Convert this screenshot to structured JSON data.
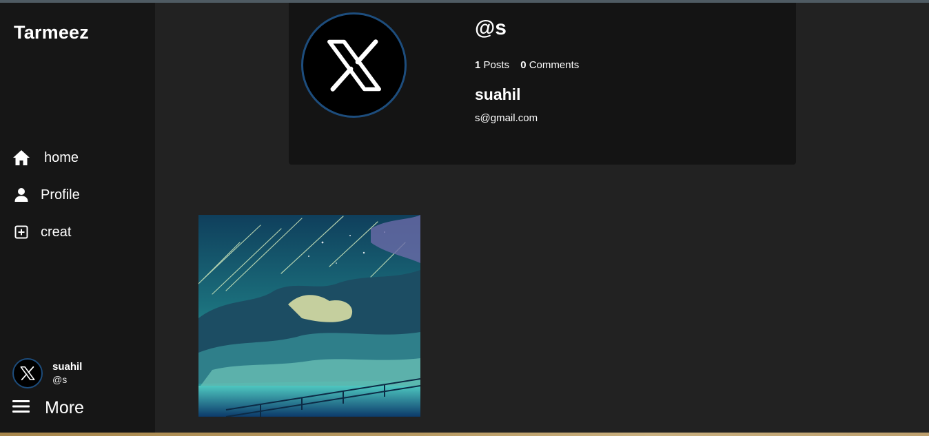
{
  "sidebar": {
    "brand": "Tarmeez",
    "nav": [
      {
        "label": "home",
        "icon": "home-icon"
      },
      {
        "label": "Profile",
        "icon": "user-icon"
      },
      {
        "label": "creat",
        "icon": "plus-square-icon"
      }
    ],
    "user": {
      "name": "suahil",
      "handle": "@s",
      "avatar_icon": "x-logo-icon"
    },
    "more_label": "More",
    "more_icon": "hamburger-menu-icon"
  },
  "profile": {
    "avatar_icon": "x-logo-icon",
    "handle": "@s",
    "posts_count": "1",
    "posts_label": "Posts",
    "comments_count": "0",
    "comments_label": "Comments",
    "name": "suahil",
    "email": "s@gmail.com"
  },
  "posts": [
    {
      "image": "night-sky-meteor-shower-illustration"
    }
  ],
  "colors": {
    "page_bg": "#222222",
    "sidebar_bg": "#161616",
    "card_bg": "#141414",
    "avatar_ring": "#1d4d7d",
    "text": "#ffffff"
  }
}
